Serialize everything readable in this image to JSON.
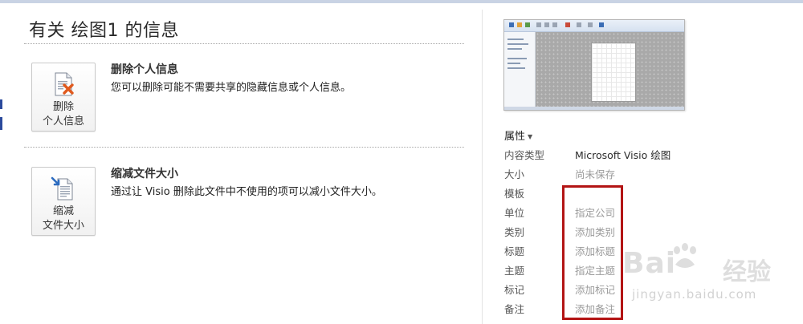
{
  "header": {
    "title": "有关 绘图1 的信息"
  },
  "actions": [
    {
      "button_line1": "删除",
      "button_line2": "个人信息",
      "icon": "document-remove-icon",
      "heading": "删除个人信息",
      "description": "您可以删除可能不需要共享的隐藏信息或个人信息。"
    },
    {
      "button_line1": "缩减",
      "button_line2": "文件大小",
      "icon": "document-compress-icon",
      "heading": "缩减文件大小",
      "description": "通过让 Visio 删除此文件中不使用的项可以减小文件大小。"
    }
  ],
  "properties": {
    "header": "属性",
    "items": [
      {
        "label": "内容类型",
        "value": "Microsoft Visio 绘图"
      },
      {
        "label": "大小",
        "value": "尚未保存"
      },
      {
        "label": "模板",
        "value": ""
      },
      {
        "label": "单位",
        "value": "指定公司"
      },
      {
        "label": "类别",
        "value": "添加类别"
      },
      {
        "label": "标题",
        "value": "添加标题"
      },
      {
        "label": "主题",
        "value": "指定主题"
      },
      {
        "label": "标记",
        "value": "添加标记"
      },
      {
        "label": "备注",
        "value": "添加备注"
      }
    ]
  },
  "watermark": {
    "brand": "Bai",
    "brand_cn": "经验",
    "url": "jingyan.baidu.com"
  },
  "colors": {
    "highlight": "#b31414",
    "accent": "#2b4a9c",
    "placeholder": "#9a9a9a"
  }
}
